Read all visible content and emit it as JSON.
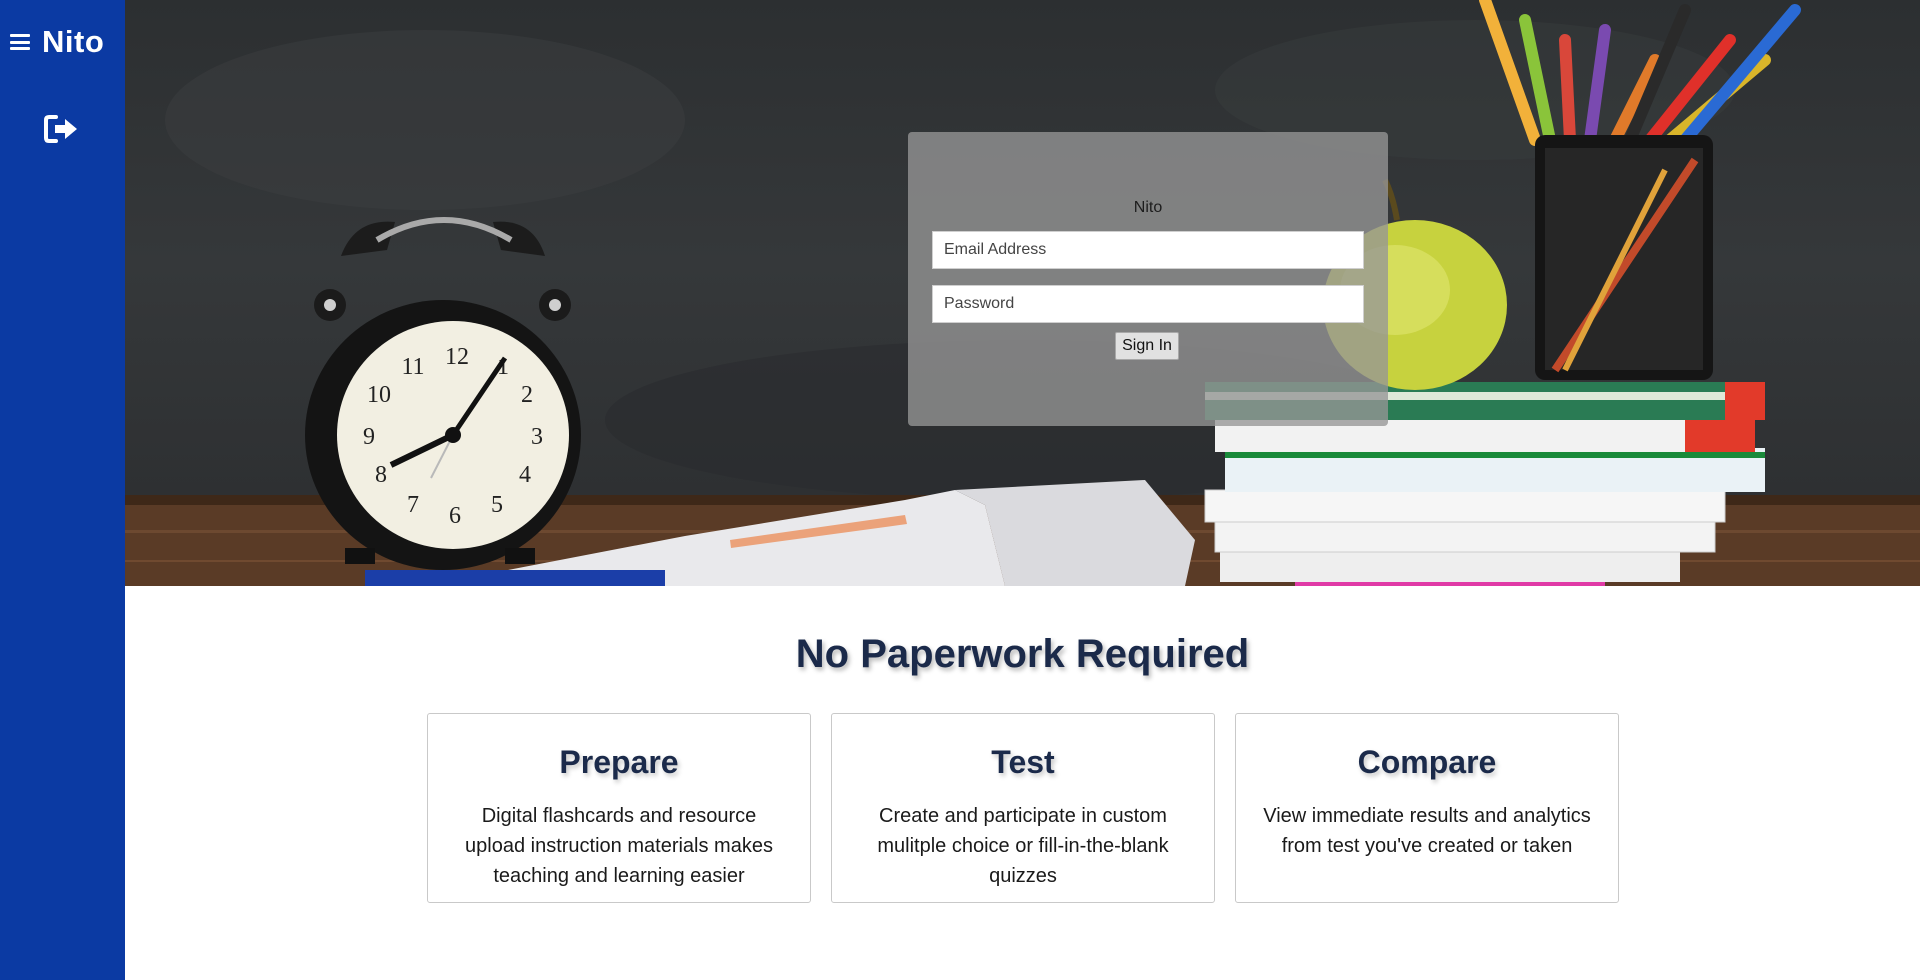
{
  "sidebar": {
    "brand": "Nito",
    "menu_icon": "hamburger-menu-icon",
    "logout_icon": "sign-out-icon",
    "color": "#0b3aa3"
  },
  "login": {
    "title": "Nito",
    "email_placeholder": "Email Address",
    "password_placeholder": "Password",
    "signin_label": "Sign In"
  },
  "features": {
    "headline": "No Paperwork Required",
    "cards": [
      {
        "title": "Prepare",
        "text": "Digital flashcards and resource upload instruction materials makes teaching and learning easier"
      },
      {
        "title": "Test",
        "text": "Create and participate in custom mulitple choice or fill-in-the-blank quizzes"
      },
      {
        "title": "Compare",
        "text": "View immediate results and analytics from test you've created or taken"
      }
    ]
  },
  "colors": {
    "heading": "#1b2a4a",
    "login_panel": "#969696"
  }
}
